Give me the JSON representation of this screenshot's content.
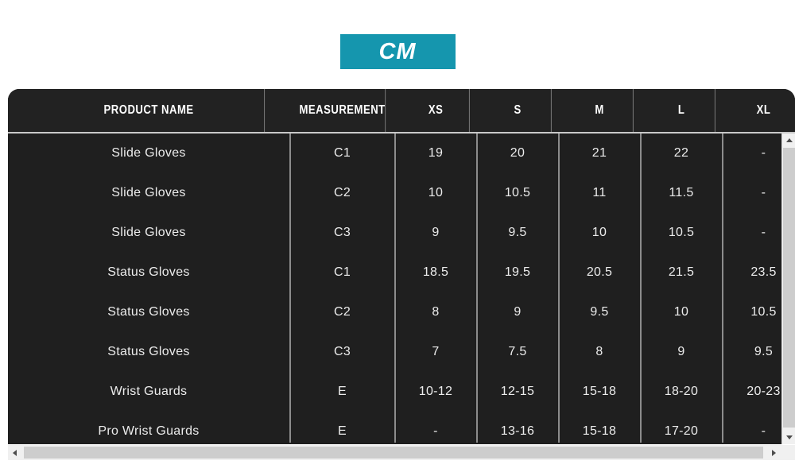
{
  "unit": {
    "label": "CM",
    "accent_color": "#1596ae"
  },
  "table": {
    "columns": [
      {
        "key": "product",
        "label": "PRODUCT NAME"
      },
      {
        "key": "measurement",
        "label": "MEASUREMENT"
      },
      {
        "key": "xs",
        "label": "XS"
      },
      {
        "key": "s",
        "label": "S"
      },
      {
        "key": "m",
        "label": "M"
      },
      {
        "key": "l",
        "label": "L"
      },
      {
        "key": "xl",
        "label": "XL"
      }
    ],
    "rows": [
      {
        "product": "Slide Gloves",
        "measurement": "C1",
        "xs": "19",
        "s": "20",
        "m": "21",
        "l": "22",
        "xl": "-"
      },
      {
        "product": "Slide Gloves",
        "measurement": "C2",
        "xs": "10",
        "s": "10.5",
        "m": "11",
        "l": "11.5",
        "xl": "-"
      },
      {
        "product": "Slide Gloves",
        "measurement": "C3",
        "xs": "9",
        "s": "9.5",
        "m": "10",
        "l": "10.5",
        "xl": "-"
      },
      {
        "product": "Status Gloves",
        "measurement": "C1",
        "xs": "18.5",
        "s": "19.5",
        "m": "20.5",
        "l": "21.5",
        "xl": "23.5"
      },
      {
        "product": "Status Gloves",
        "measurement": "C2",
        "xs": "8",
        "s": "9",
        "m": "9.5",
        "l": "10",
        "xl": "10.5"
      },
      {
        "product": "Status Gloves",
        "measurement": "C3",
        "xs": "7",
        "s": "7.5",
        "m": "8",
        "l": "9",
        "xl": "9.5"
      },
      {
        "product": "Wrist Guards",
        "measurement": "E",
        "xs": "10-12",
        "s": "12-15",
        "m": "15-18",
        "l": "18-20",
        "xl": "20-23"
      },
      {
        "product": "Pro Wrist Guards",
        "measurement": "E",
        "xs": "-",
        "s": "13-16",
        "m": "15-18",
        "l": "17-20",
        "xl": "-"
      }
    ]
  },
  "scrollbars": {
    "vertical": {
      "up_arrow": "scroll-up-arrow-icon",
      "down_arrow": "scroll-down-arrow-icon"
    },
    "horizontal": {
      "left_arrow": "scroll-left-arrow-icon",
      "right_arrow": "scroll-right-arrow-icon"
    }
  }
}
